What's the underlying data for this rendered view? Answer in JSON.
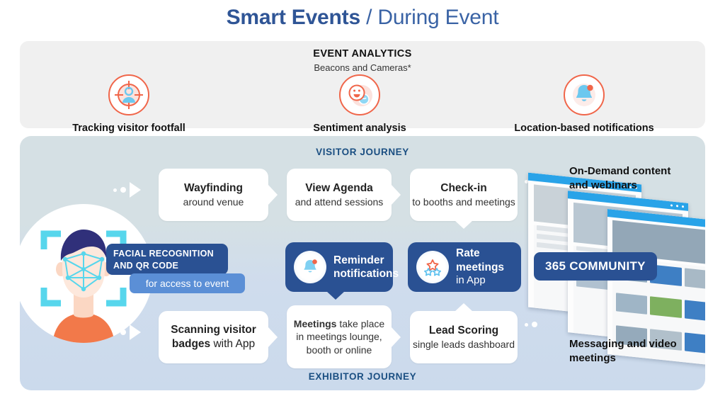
{
  "title": {
    "strong": "Smart Events",
    "separator": " / ",
    "light": "During Event"
  },
  "analytics": {
    "heading": "EVENT ANALYTICS",
    "subheading": "Beacons and Cameras*",
    "items": [
      {
        "icon": "target-person-icon",
        "label": "Tracking visitor footfall"
      },
      {
        "icon": "smiley-sentiment-icon",
        "label": "Sentiment analysis"
      },
      {
        "icon": "bell-notification-icon",
        "label": "Location-based notifications"
      }
    ]
  },
  "stage": {
    "visitor_journey_label": "VISITOR JOURNEY",
    "exhibitor_journey_label": "EXHIBITOR JOURNEY",
    "facial_pill": {
      "line1": "FACIAL RECOGNITION",
      "line2": "AND QR CODE",
      "sub": "for access to event"
    },
    "visitor_cards": [
      {
        "bold": "Wayfinding",
        "normal": "around venue"
      },
      {
        "bold": "View Agenda",
        "normal": "and attend sessions"
      },
      {
        "bold": "Check-in",
        "normal": "to booths and meetings"
      }
    ],
    "middle_cards": [
      {
        "icon": "bell-notification-icon",
        "bold": "Reminder",
        "normal": "notifications"
      },
      {
        "icon": "stars-rating-icon",
        "bold": "Rate meetings",
        "normal": "in App"
      }
    ],
    "exhibitor_cards": [
      {
        "bold": "Scanning visitor",
        "bold2": "badges",
        "normal": " with App"
      },
      {
        "bold": "Meetings",
        "normal": " take place",
        "line2": "in meetings lounge,",
        "line3": "booth or online"
      },
      {
        "bold": "Lead Scoring",
        "normal": "single leads dashboard"
      }
    ],
    "right": {
      "top_label_line1": "On-Demand content",
      "top_label_line2": "and webinars",
      "badge": "365 COMMUNITY",
      "bottom_label_line1": "Messaging and video",
      "bottom_label_line2": "meetings"
    }
  },
  "colors": {
    "title_blue": "#2f5596",
    "accent_orange": "#f0664a",
    "dark_blue": "#2a5193",
    "light_blue": "#5b8fd6",
    "panel_gray": "#f0f0f0",
    "cyan": "#57d6ec"
  }
}
